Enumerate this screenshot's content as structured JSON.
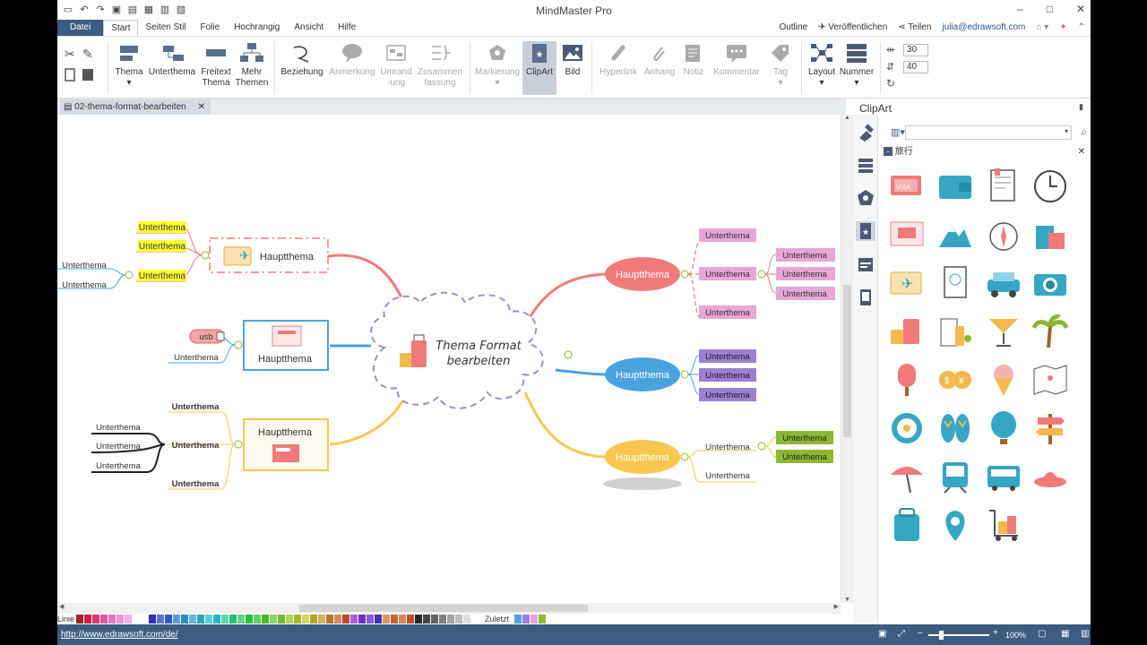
{
  "app": {
    "title": "MindMaster Pro"
  },
  "window_controls": {
    "minimize": "–",
    "maximize": "□",
    "close": "✕"
  },
  "menu_tabs": [
    "Datei",
    "Start",
    "Seiten Stil",
    "Folie",
    "Hochrangig",
    "Ansicht",
    "Hilfe"
  ],
  "menu_right": {
    "outline": "Outline",
    "publish": "Veröffentlichen",
    "share": "Teilen",
    "user": "julia@edrawsoft.com"
  },
  "ribbon": {
    "buttons": [
      {
        "label": "Thema",
        "sub": "▾"
      },
      {
        "label": "Unterthema",
        "sub": ""
      },
      {
        "label": "Freitext",
        "sub": "Thema"
      },
      {
        "label": "Mehr",
        "sub": "Themen"
      },
      {
        "label": "Beziehung",
        "sub": ""
      },
      {
        "label": "Anmerkung",
        "sub": ""
      },
      {
        "label": "Umrand",
        "sub": "-ung"
      },
      {
        "label": "Zusammen",
        "sub": "fassung"
      },
      {
        "label": "Markierung",
        "sub": "▾"
      },
      {
        "label": "ClipArt",
        "sub": ""
      },
      {
        "label": "Bild",
        "sub": ""
      },
      {
        "label": "Hyperlink",
        "sub": ""
      },
      {
        "label": "Anhang",
        "sub": ""
      },
      {
        "label": "Notiz",
        "sub": ""
      },
      {
        "label": "Kommentar",
        "sub": ""
      },
      {
        "label": "Tag",
        "sub": "▾"
      },
      {
        "label": "Layout",
        "sub": "▾"
      },
      {
        "label": "Nummer",
        "sub": "▾"
      }
    ],
    "spin1": "30",
    "spin2": "40"
  },
  "document_tab": {
    "name": "02-thema-format-bearbeiten"
  },
  "mindmap": {
    "central": {
      "line1": "Thema Format",
      "line2": "bearbeiten"
    },
    "left_topics": [
      "Hauptthema",
      "Hauptthema",
      "Hauptthema"
    ],
    "left1_subs": [
      "Unterthema",
      "Unterthema",
      "Unterthema"
    ],
    "left1_sub3_children": [
      "Unterthema",
      "Unterthema"
    ],
    "left2_usb": "usb",
    "left2_sub": "Unterthema",
    "left3_subs": [
      "Unterthema",
      "Unterthema",
      "Unterthema"
    ],
    "left3_sub2_children": [
      "Unterthema",
      "Unterthema",
      "Unterthema"
    ],
    "right_topics": [
      "Hauptthema",
      "Hauptthema",
      "Hauptthema"
    ],
    "right1_subs": [
      "Unterthema",
      "Unterthema",
      "Unterthema"
    ],
    "right1_sub2_children": [
      "Unterthema",
      "Unterthema",
      "Unterthema"
    ],
    "right2_subs": [
      "Unterthema",
      "Unterthema",
      "Unterthema"
    ],
    "right3_subs": [
      "Unterthema",
      "Unterthema"
    ],
    "right3_sub1_children": [
      "Unterthema",
      "Unterthema"
    ],
    "colors": {
      "red": "#f07a7a",
      "blue": "#4aa3df",
      "yellow": "#f9c74f",
      "pink": "#e6a6d6",
      "purple": "#9b7fd4",
      "green": "#8bb832",
      "highlight": "#ffff33"
    }
  },
  "palette": {
    "left_label": "Linie",
    "right_label": "Zuletzt"
  },
  "status": {
    "url": "http://www.edrawsoft.com/de/",
    "zoom": "100%"
  },
  "panel": {
    "title": "ClipArt",
    "category": "旅行",
    "search_placeholder": ""
  }
}
